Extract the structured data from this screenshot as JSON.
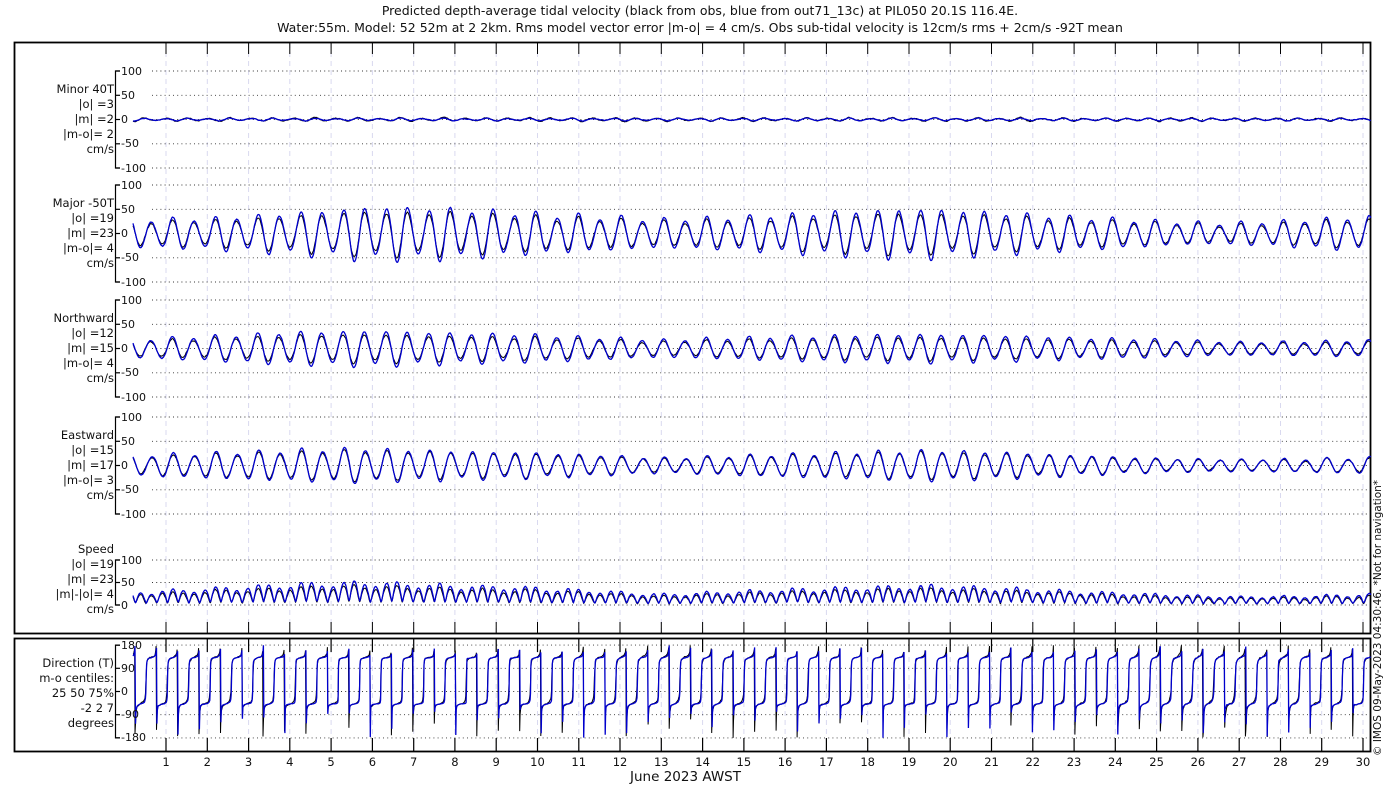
{
  "title_line1": "Predicted depth-average tidal velocity (black from obs, blue from out71_13c) at PIL050 20.1S 116.4E.",
  "title_line2": "Water:55m. Model: 52 52m at 2 2km. Rms model vector error |m-o| = 4 cm/s. Obs sub-tidal velocity is 12cm/s rms + 2cm/s -92T mean",
  "watermark": "© IMOS 09-May-2023 04:30:46. *Not for navigation*",
  "x_axis": {
    "title": "June 2023 AWST",
    "day_labels": [
      "1",
      "2",
      "3",
      "4",
      "5",
      "6",
      "7",
      "8",
      "9",
      "10",
      "11",
      "12",
      "13",
      "14",
      "15",
      "16",
      "17",
      "18",
      "19",
      "20",
      "21",
      "22",
      "23",
      "24",
      "25",
      "26",
      "27",
      "28",
      "29",
      "30"
    ],
    "start_day": 0.2,
    "end_day": 30.2
  },
  "colors": {
    "model": "#0000cd",
    "obs": "#000000",
    "day_grid": "#d9d9ef",
    "h_grid": "#111111",
    "frame": "#000000"
  },
  "legend": {
    "obs": "black from obs",
    "model": "blue from out71_13c"
  },
  "chart_data": [
    {
      "type": "line",
      "name": "minor",
      "label_lines": [
        "Minor 40T",
        "|o| =3",
        "|m| =2",
        "|m-o|= 2",
        "cm/s"
      ],
      "y_ticks": [
        100,
        50,
        0,
        -50,
        -100
      ],
      "ylim": [
        -100,
        100
      ],
      "unit": "cm/s",
      "series": [
        "obs",
        "model"
      ],
      "wave": {
        "period_days": 0.5175,
        "phase": 2.0,
        "ineq_amp": 0.3,
        "ineq_period_days": 1.0758,
        "ineq_phase": 0.0,
        "envelope_day_amp": [
          [
            0,
            2.2
          ],
          [
            30,
            2.2
          ]
        ],
        "noise": 0.6
      },
      "obs": {
        "scale": 1.4,
        "phase_lag": 0.05,
        "noise": 0.9
      },
      "seed": 11
    },
    {
      "type": "line",
      "name": "major",
      "label_lines": [
        "Major -50T",
        "|o| =19",
        "|m| =23",
        "|m-o|= 4",
        "cm/s"
      ],
      "y_ticks": [
        100,
        50,
        0,
        -50,
        -100
      ],
      "ylim": [
        -100,
        100
      ],
      "unit": "cm/s",
      "series": [
        "obs",
        "model"
      ],
      "wave": {
        "period_days": 0.5175,
        "phase": 0.0,
        "ineq_amp": 0.18,
        "ineq_period_days": 1.0758,
        "ineq_phase": 0.5,
        "envelope_day_amp": [
          [
            0,
            27
          ],
          [
            2,
            30
          ],
          [
            4,
            40
          ],
          [
            6,
            52
          ],
          [
            8,
            49
          ],
          [
            10,
            40
          ],
          [
            13,
            28
          ],
          [
            15,
            33
          ],
          [
            17,
            42
          ],
          [
            19,
            48
          ],
          [
            21,
            42
          ],
          [
            23,
            33
          ],
          [
            25,
            25
          ],
          [
            26.5,
            20
          ],
          [
            28,
            25
          ],
          [
            30,
            33
          ]
        ],
        "noise": 0.9
      },
      "obs": {
        "scale": 0.83,
        "phase_lag": 0.06,
        "noise": 1.4
      },
      "seed": 22
    },
    {
      "type": "line",
      "name": "northward",
      "label_lines": [
        "Northward",
        "|o| =12",
        "|m| =15",
        "|m-o|= 4",
        "cm/s"
      ],
      "y_ticks": [
        100,
        50,
        0,
        -50,
        -100
      ],
      "ylim": [
        -100,
        100
      ],
      "unit": "cm/s",
      "series": [
        "obs",
        "model"
      ],
      "wave": {
        "period_days": 0.5175,
        "phase": 0.15,
        "ineq_amp": 0.15,
        "ineq_period_days": 1.0758,
        "ineq_phase": 0.8,
        "envelope_day_amp": [
          [
            0,
            18
          ],
          [
            2,
            24
          ],
          [
            4,
            32
          ],
          [
            6,
            35
          ],
          [
            8,
            30
          ],
          [
            10,
            27
          ],
          [
            13,
            17
          ],
          [
            15,
            22
          ],
          [
            17,
            26
          ],
          [
            19,
            28
          ],
          [
            21,
            26
          ],
          [
            23,
            21
          ],
          [
            25,
            18
          ],
          [
            27,
            13
          ],
          [
            28.5,
            14
          ],
          [
            30,
            16
          ]
        ],
        "noise": 0.8
      },
      "obs": {
        "scale": 0.8,
        "phase_lag": 0.05,
        "noise": 1.3
      },
      "seed": 33
    },
    {
      "type": "line",
      "name": "eastward",
      "label_lines": [
        "Eastward",
        "|o| =15",
        "|m| =17",
        "|m-o|= 3",
        "cm/s"
      ],
      "y_ticks": [
        100,
        50,
        0,
        -50,
        -100
      ],
      "ylim": [
        -100,
        100
      ],
      "unit": "cm/s",
      "series": [
        "obs",
        "model"
      ],
      "wave": {
        "period_days": 0.5175,
        "phase": -0.2,
        "ineq_amp": 0.15,
        "ineq_period_days": 1.0758,
        "ineq_phase": 1.2,
        "envelope_day_amp": [
          [
            0,
            20
          ],
          [
            2,
            25
          ],
          [
            4,
            30
          ],
          [
            5.5,
            34
          ],
          [
            8,
            28
          ],
          [
            10,
            25
          ],
          [
            13,
            15
          ],
          [
            15,
            20
          ],
          [
            17,
            25
          ],
          [
            19.5,
            30
          ],
          [
            21,
            27
          ],
          [
            23,
            20
          ],
          [
            25,
            14
          ],
          [
            27,
            12
          ],
          [
            28.5,
            13
          ],
          [
            30,
            16
          ]
        ],
        "noise": 0.8
      },
      "obs": {
        "scale": 0.88,
        "phase_lag": 0.05,
        "noise": 1.3
      },
      "seed": 44
    },
    {
      "type": "line",
      "name": "speed",
      "label_lines": [
        "Speed",
        "|o| =19",
        "|m| =23",
        "|m|-|o|= 4",
        "cm/s"
      ],
      "y_ticks": [
        100,
        50,
        0
      ],
      "ylim": [
        0,
        100
      ],
      "unit": "cm/s",
      "series": [
        "obs",
        "model"
      ],
      "computed_from": [
        "eastward",
        "northward"
      ]
    },
    {
      "type": "line",
      "name": "direction",
      "label_lines": [
        "Direction (T)",
        "m-o centiles:",
        "25  50  75%",
        "-2  2  7",
        "degrees"
      ],
      "y_ticks": [
        180,
        90,
        0,
        -90,
        -180
      ],
      "ylim": [
        -180,
        180
      ],
      "unit": "degrees",
      "series": [
        "obs",
        "model"
      ],
      "computed_from": [
        "major",
        "minor"
      ],
      "ebb_bearing_deg": 130,
      "flood_bearing_deg": -50
    }
  ]
}
